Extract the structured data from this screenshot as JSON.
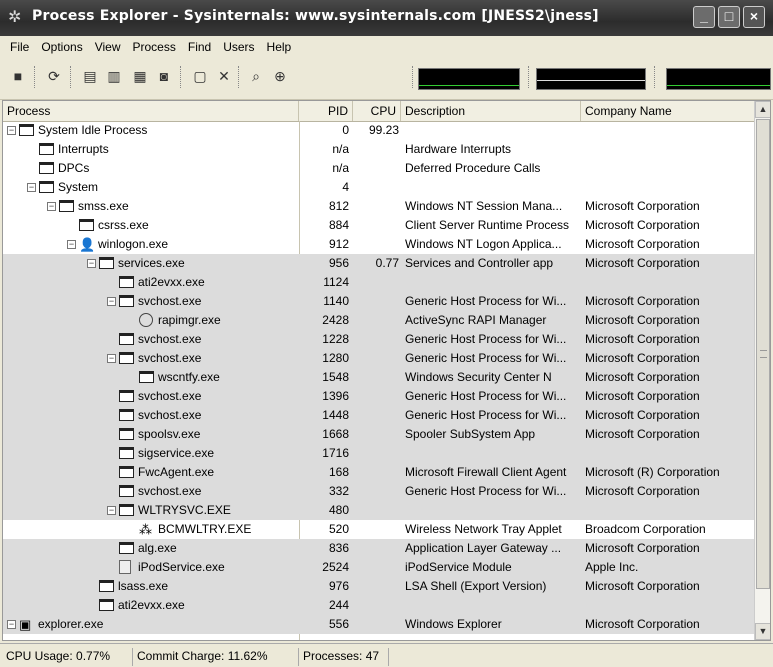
{
  "window": {
    "title": "Process Explorer - Sysinternals: www.sysinternals.com [JNESS2\\jness]"
  },
  "menu": [
    "File",
    "Options",
    "View",
    "Process",
    "Find",
    "Users",
    "Help"
  ],
  "columns": {
    "process": "Process",
    "pid": "PID",
    "cpu": "CPU",
    "description": "Description",
    "company": "Company Name"
  },
  "processes": [
    {
      "name": "System Idle Process",
      "pid": "0",
      "cpu": "99.23",
      "desc": "",
      "company": "",
      "hl": false
    },
    {
      "name": "Interrupts",
      "pid": "n/a",
      "cpu": "",
      "desc": "Hardware Interrupts",
      "company": "",
      "hl": false
    },
    {
      "name": "DPCs",
      "pid": "n/a",
      "cpu": "",
      "desc": "Deferred Procedure Calls",
      "company": "",
      "hl": false
    },
    {
      "name": "System",
      "pid": "4",
      "cpu": "",
      "desc": "",
      "company": "",
      "hl": false
    },
    {
      "name": "smss.exe",
      "pid": "812",
      "cpu": "",
      "desc": "Windows NT Session Mana...",
      "company": "Microsoft Corporation",
      "hl": false
    },
    {
      "name": "csrss.exe",
      "pid": "884",
      "cpu": "",
      "desc": "Client Server Runtime Process",
      "company": "Microsoft Corporation",
      "hl": false
    },
    {
      "name": "winlogon.exe",
      "pid": "912",
      "cpu": "",
      "desc": "Windows NT Logon Applica...",
      "company": "Microsoft Corporation",
      "hl": false
    },
    {
      "name": "services.exe",
      "pid": "956",
      "cpu": "0.77",
      "desc": "Services and Controller app",
      "company": "Microsoft Corporation",
      "hl": true
    },
    {
      "name": "ati2evxx.exe",
      "pid": "1124",
      "cpu": "",
      "desc": "",
      "company": "",
      "hl": true
    },
    {
      "name": "svchost.exe",
      "pid": "1140",
      "cpu": "",
      "desc": "Generic Host Process for Wi...",
      "company": "Microsoft Corporation",
      "hl": true
    },
    {
      "name": "rapimgr.exe",
      "pid": "2428",
      "cpu": "",
      "desc": "ActiveSync RAPI Manager",
      "company": "Microsoft Corporation",
      "hl": true
    },
    {
      "name": "svchost.exe",
      "pid": "1228",
      "cpu": "",
      "desc": "Generic Host Process for Wi...",
      "company": "Microsoft Corporation",
      "hl": true
    },
    {
      "name": "svchost.exe",
      "pid": "1280",
      "cpu": "",
      "desc": "Generic Host Process for Wi...",
      "company": "Microsoft Corporation",
      "hl": true
    },
    {
      "name": "wscntfy.exe",
      "pid": "1548",
      "cpu": "",
      "desc": "Windows Security Center N",
      "company": "Microsoft Corporation",
      "hl": true
    },
    {
      "name": "svchost.exe",
      "pid": "1396",
      "cpu": "",
      "desc": "Generic Host Process for Wi...",
      "company": "Microsoft Corporation",
      "hl": true
    },
    {
      "name": "svchost.exe",
      "pid": "1448",
      "cpu": "",
      "desc": "Generic Host Process for Wi...",
      "company": "Microsoft Corporation",
      "hl": true
    },
    {
      "name": "spoolsv.exe",
      "pid": "1668",
      "cpu": "",
      "desc": "Spooler SubSystem App",
      "company": "Microsoft Corporation",
      "hl": true
    },
    {
      "name": "sigservice.exe",
      "pid": "1716",
      "cpu": "",
      "desc": "",
      "company": "",
      "hl": true
    },
    {
      "name": "FwcAgent.exe",
      "pid": "168",
      "cpu": "",
      "desc": "Microsoft Firewall Client Agent",
      "company": "Microsoft (R) Corporation",
      "hl": true
    },
    {
      "name": "svchost.exe",
      "pid": "332",
      "cpu": "",
      "desc": "Generic Host Process for Wi...",
      "company": "Microsoft Corporation",
      "hl": true
    },
    {
      "name": "WLTRYSVC.EXE",
      "pid": "480",
      "cpu": "",
      "desc": "",
      "company": "",
      "hl": true
    },
    {
      "name": "BCMWLTRY.EXE",
      "pid": "520",
      "cpu": "",
      "desc": "Wireless Network Tray Applet",
      "company": "Broadcom Corporation",
      "hl": false
    },
    {
      "name": "alg.exe",
      "pid": "836",
      "cpu": "",
      "desc": "Application Layer Gateway ...",
      "company": "Microsoft Corporation",
      "hl": true
    },
    {
      "name": "iPodService.exe",
      "pid": "2524",
      "cpu": "",
      "desc": "iPodService Module",
      "company": "Apple Inc.",
      "hl": true
    },
    {
      "name": "lsass.exe",
      "pid": "976",
      "cpu": "",
      "desc": "LSA Shell (Export Version)",
      "company": "Microsoft Corporation",
      "hl": true
    },
    {
      "name": "ati2evxx.exe",
      "pid": "244",
      "cpu": "",
      "desc": "",
      "company": "",
      "hl": true
    },
    {
      "name": "explorer.exe",
      "pid": "556",
      "cpu": "",
      "desc": "Windows Explorer",
      "company": "Microsoft Corporation",
      "hl": true
    }
  ],
  "status": {
    "cpu": "CPU Usage: 0.77%",
    "commit": "Commit Charge: 11.62%",
    "processes": "Processes: 47"
  }
}
